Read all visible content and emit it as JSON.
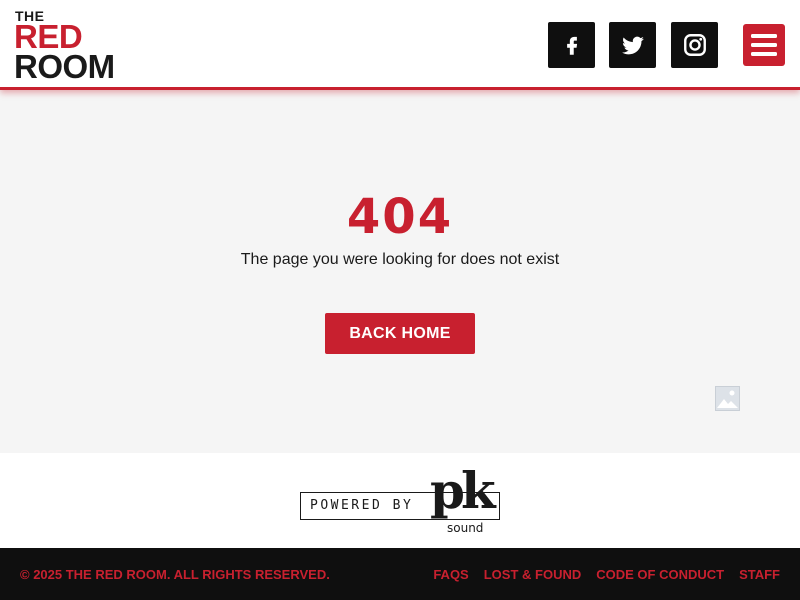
{
  "header": {
    "logo": {
      "line1": "THE",
      "line2": "RED",
      "line3": "ROOM"
    },
    "social": [
      {
        "name": "facebook",
        "icon": "facebook-icon"
      },
      {
        "name": "twitter",
        "icon": "twitter-icon"
      },
      {
        "name": "instagram",
        "icon": "instagram-icon"
      }
    ],
    "menu_icon": "hamburger-menu-icon"
  },
  "main": {
    "error_code": "404",
    "message": "The page you were looking for does not exist",
    "back_button": "BACK HOME",
    "broken_image_icon": "broken-image-icon"
  },
  "powered": {
    "label": "POWERED BY",
    "brand_letters": "pk",
    "brand_sub": "sound"
  },
  "footer": {
    "copyright": "© 2025 THE RED ROOM. ALL RIGHTS RESERVED.",
    "links": [
      "FAQS",
      "LOST & FOUND",
      "CODE OF CONDUCT",
      "STAFF"
    ]
  },
  "colors": {
    "brand_red": "#c8202f",
    "dark": "#0f0f0f",
    "background": "#f5f5f5"
  }
}
